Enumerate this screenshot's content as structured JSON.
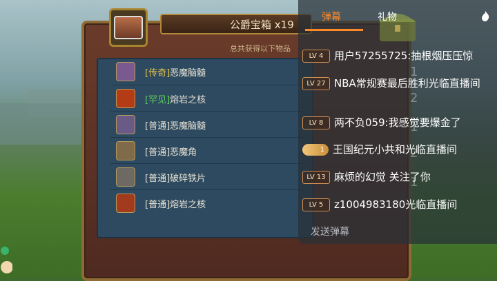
{
  "chest": {
    "title": "公爵宝箱 x19",
    "subtitle": "总共获得以下物品"
  },
  "items": [
    {
      "tag": "[传奇]",
      "tag_color": "#e6c247",
      "name": "恶魔脑髓",
      "icon": "demon-brain-icon",
      "icon_color": "#7a5a8e"
    },
    {
      "tag": "[罕见]",
      "tag_color": "#5fd35a",
      "name": "熔岩之核",
      "icon": "lava-core-icon",
      "icon_color": "#b33b16"
    },
    {
      "tag": "[普通]",
      "tag_color": "#e8e2d3",
      "name": "恶魔脑髓",
      "icon": "demon-brain-icon",
      "icon_color": "#6a5a86"
    },
    {
      "tag": "[普通]",
      "tag_color": "#e8e2d3",
      "name": "恶魔角",
      "icon": "demon-horn-icon",
      "icon_color": "#7f6a4a"
    },
    {
      "tag": "[普通]",
      "tag_color": "#e8e2d3",
      "name": "破碎铁片",
      "icon": "iron-shard-icon",
      "icon_color": "#6e6a63"
    },
    {
      "tag": "[普通]",
      "tag_color": "#e8e2d3",
      "name": "熔岩之核",
      "icon": "lava-core-icon",
      "icon_color": "#a23a1e"
    }
  ],
  "chat": {
    "tabs": [
      "弹幕",
      "礼物"
    ],
    "messages": [
      {
        "level": "LV 4",
        "user": "用户57255725",
        "text": ":抽根烟压压惊"
      },
      {
        "level": "LV 27",
        "user": "NBA常规赛最后胜利",
        "text": "光临直播间"
      },
      {
        "level": "LV 8",
        "user": "两不负059",
        "text": ":我感觉要爆金了"
      },
      {
        "level": "1",
        "user": "王国纪元小共和",
        "text": "光临直播间"
      },
      {
        "level": "LV 13",
        "user": "麻烦的幻觉",
        "text": " 关注了你"
      },
      {
        "level": "LV 5",
        "user": "z1004983180",
        "text": "光临直播间"
      }
    ],
    "ghost_numbers": [
      "1",
      "2",
      "1",
      "2",
      "1"
    ],
    "send_placeholder": "发送弹幕"
  }
}
